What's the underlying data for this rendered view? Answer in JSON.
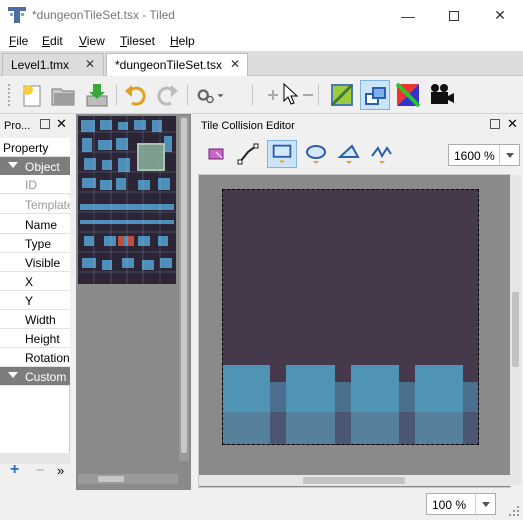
{
  "window": {
    "title": "*dungeonTileSet.tsx - Tiled"
  },
  "menu": [
    {
      "label": "File",
      "key": "F",
      "rest": "ile"
    },
    {
      "label": "Edit",
      "key": "E",
      "rest": "dit"
    },
    {
      "label": "View",
      "key": "V",
      "rest": "iew"
    },
    {
      "label": "Tileset",
      "key": "T",
      "rest": "ileset"
    },
    {
      "label": "Help",
      "key": "H",
      "rest": "elp"
    }
  ],
  "tabs": [
    {
      "label": "Level1.tmx",
      "close": "✕",
      "active": false
    },
    {
      "label": "*dungeonTileSet.tsx",
      "close": "✕",
      "active": true
    }
  ],
  "properties_panel": {
    "title": "Pro...",
    "header": "Property",
    "rows": [
      {
        "label": "Object",
        "type": "group"
      },
      {
        "label": "ID",
        "type": "disabled"
      },
      {
        "label": "Template",
        "type": "disabled"
      },
      {
        "label": "Name",
        "type": "normal"
      },
      {
        "label": "Type",
        "type": "normal"
      },
      {
        "label": "Visible",
        "type": "normal"
      },
      {
        "label": "X",
        "type": "normal"
      },
      {
        "label": "Y",
        "type": "normal"
      },
      {
        "label": "Width",
        "type": "normal"
      },
      {
        "label": "Height",
        "type": "normal"
      },
      {
        "label": "Rotation",
        "type": "normal"
      },
      {
        "label": "Custom",
        "type": "group"
      }
    ],
    "footer": {
      "add": "+",
      "remove": "−",
      "more": "»"
    }
  },
  "collision_editor": {
    "title": "Tile Collision Editor",
    "zoom": "1600 %"
  },
  "bottom_zoom": "100 %",
  "colors": {
    "tile_bg": "#46394b",
    "floor_light": "#4f93b5",
    "floor_dark": "#55819d",
    "accent": "#3c6ea8"
  }
}
